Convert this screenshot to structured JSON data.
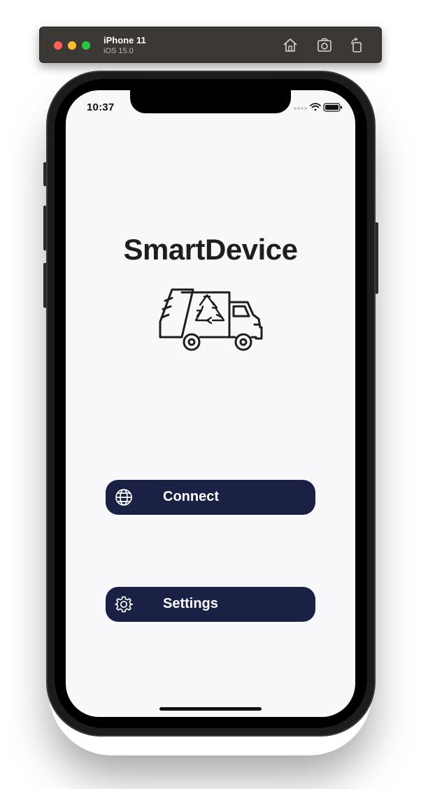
{
  "simulator": {
    "device_name": "iPhone 11",
    "os_version": "iOS 15.0",
    "icons": [
      "home-icon",
      "screenshot-icon",
      "rotate-icon"
    ]
  },
  "status_bar": {
    "time": "10:37",
    "icons": [
      "signal-icon",
      "wifi-icon",
      "battery-icon"
    ]
  },
  "app": {
    "title": "SmartDevice",
    "logo_icon": "recycling-truck-icon"
  },
  "buttons": {
    "connect": {
      "label": "Connect",
      "icon": "globe-icon"
    },
    "settings": {
      "label": "Settings",
      "icon": "gear-icon"
    }
  },
  "colors": {
    "button_background": "#1b2145",
    "screen_background": "#f8f8fa",
    "title_text": "#1e1e1e"
  }
}
